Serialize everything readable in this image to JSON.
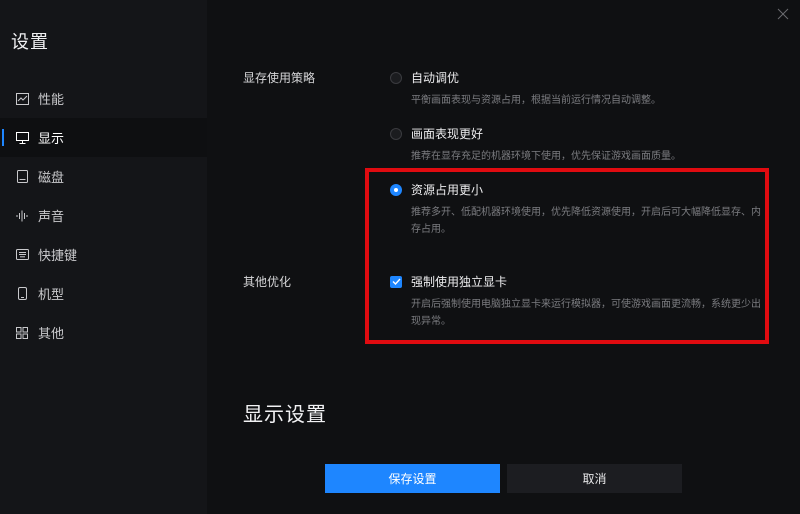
{
  "sidebar": {
    "title": "设置",
    "items": [
      {
        "label": "性能",
        "icon": "chart-icon",
        "active": false
      },
      {
        "label": "显示",
        "icon": "monitor-icon",
        "active": true
      },
      {
        "label": "磁盘",
        "icon": "disk-icon",
        "active": false
      },
      {
        "label": "声音",
        "icon": "sound-icon",
        "active": false
      },
      {
        "label": "快捷键",
        "icon": "keyboard-icon",
        "active": false
      },
      {
        "label": "机型",
        "icon": "phone-icon",
        "active": false
      },
      {
        "label": "其他",
        "icon": "grid-icon",
        "active": false
      }
    ]
  },
  "memory_strategy": {
    "label": "显存使用策略",
    "options": [
      {
        "title": "自动调优",
        "desc": "平衡画面表现与资源占用，根据当前运行情况自动调整。",
        "checked": false
      },
      {
        "title": "画面表现更好",
        "desc": "推荐在显存充足的机器环境下使用，优先保证游戏画面质量。",
        "checked": false
      },
      {
        "title": "资源占用更小",
        "desc": "推荐多开、低配机器环境使用，优先降低资源使用，开启后可大幅降低显存、内存占用。",
        "checked": true
      }
    ]
  },
  "other_optimization": {
    "label": "其他优化",
    "option": {
      "title": "强制使用独立显卡",
      "desc": "开启后强制使用电脑独立显卡来运行模拟器，可使游戏画面更流畅，系统更少出现异常。",
      "checked": true
    }
  },
  "display_settings": {
    "heading": "显示设置"
  },
  "buttons": {
    "save": "保存设置",
    "cancel": "取消"
  },
  "colors": {
    "accent": "#1e86ff",
    "highlight": "#e00b10"
  }
}
